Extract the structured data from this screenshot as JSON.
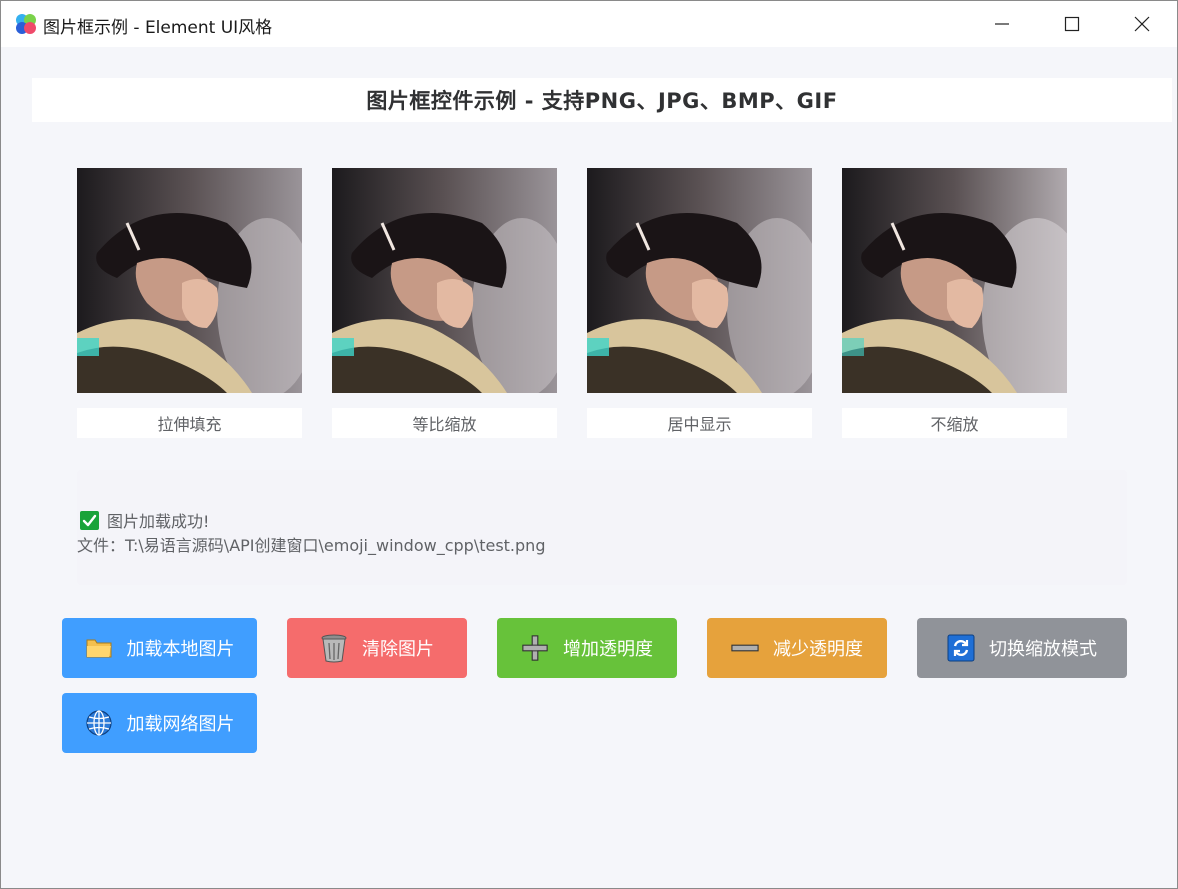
{
  "window": {
    "title": "图片框示例 - Element UI风格"
  },
  "header": {
    "title": "图片框控件示例 - 支持PNG、JPG、BMP、GIF"
  },
  "pictures": [
    {
      "label": "拉伸填充"
    },
    {
      "label": "等比缩放"
    },
    {
      "label": "居中显示"
    },
    {
      "label": "不缩放"
    }
  ],
  "status": {
    "message": "图片加载成功!",
    "file": "文件：T:\\易语言源码\\API创建窗口\\emoji_window_cpp\\test.png"
  },
  "buttons": {
    "load_local": "加载本地图片",
    "clear": "清除图片",
    "increase_opacity": "增加透明度",
    "decrease_opacity": "减少透明度",
    "toggle_mode": "切换缩放模式",
    "load_network": "加载网络图片"
  },
  "colors": {
    "primary": "#409eff",
    "danger": "#f56c6c",
    "success": "#67c23a",
    "warning": "#e6a23c",
    "info": "#909399",
    "background": "#f5f6fa"
  },
  "icons": {
    "app": "app-logo-icon",
    "load_local": "folder-icon",
    "clear": "trash-icon",
    "increase_opacity": "plus-icon",
    "decrease_opacity": "minus-icon",
    "toggle_mode": "refresh-icon",
    "load_network": "globe-icon",
    "status": "check-icon"
  }
}
